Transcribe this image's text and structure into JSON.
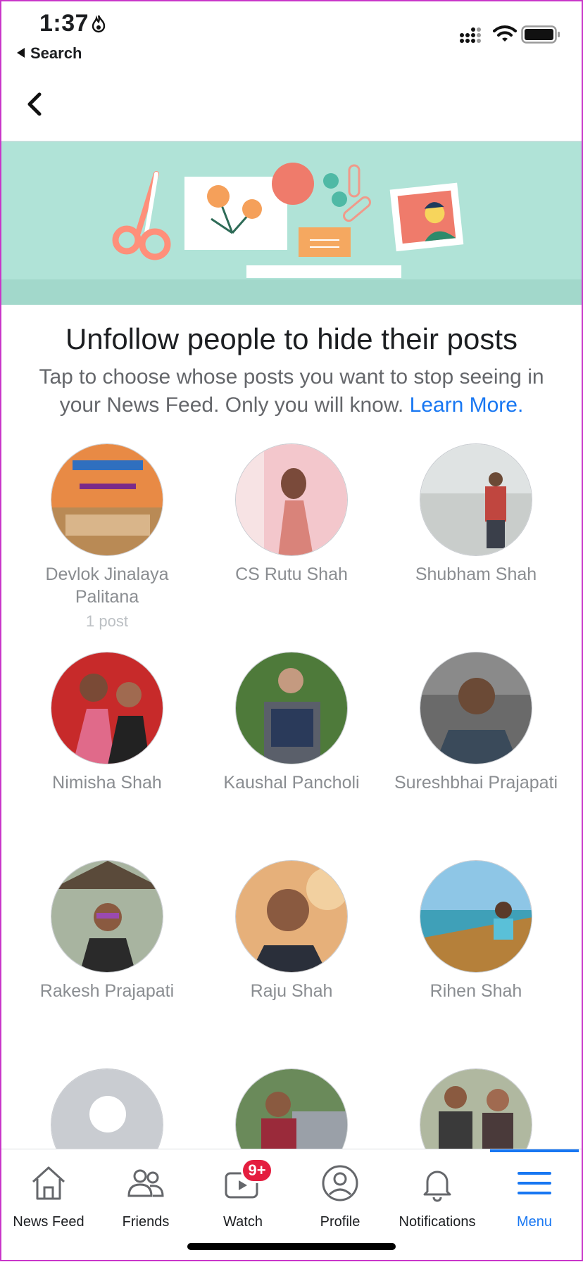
{
  "status_bar": {
    "time": "1:37",
    "back_app": "Search",
    "icons": [
      "flame-icon",
      "cellular-signal-icon",
      "wifi-icon",
      "battery-icon"
    ]
  },
  "nav": {
    "back_icon": "chevron-left-icon"
  },
  "banner": {
    "illustration": "scissors-flowers-paperclip-photo"
  },
  "header": {
    "title": "Unfollow people to hide their posts",
    "description": "Tap to choose whose posts you want to stop seeing in your News Feed. Only you will know.",
    "link": "Learn More."
  },
  "people": [
    {
      "name": "Devlok Jinalaya Palitana",
      "meta": "1 post"
    },
    {
      "name": "CS Rutu Shah",
      "meta": ""
    },
    {
      "name": "Shubham Shah",
      "meta": ""
    },
    {
      "name": "Nimisha Shah",
      "meta": ""
    },
    {
      "name": "Kaushal Pancholi",
      "meta": ""
    },
    {
      "name": "Sureshbhai Prajapati",
      "meta": ""
    },
    {
      "name": "Rakesh Prajapati",
      "meta": ""
    },
    {
      "name": "Raju Shah",
      "meta": ""
    },
    {
      "name": "Rihen Shah",
      "meta": ""
    },
    {
      "name": "",
      "meta": ""
    },
    {
      "name": "",
      "meta": ""
    },
    {
      "name": "",
      "meta": ""
    }
  ],
  "tabbar": {
    "tabs": [
      {
        "label": "News Feed",
        "icon": "home-icon"
      },
      {
        "label": "Friends",
        "icon": "friends-icon"
      },
      {
        "label": "Watch",
        "icon": "watch-icon",
        "badge": "9+"
      },
      {
        "label": "Profile",
        "icon": "profile-icon"
      },
      {
        "label": "Notifications",
        "icon": "bell-icon"
      },
      {
        "label": "Menu",
        "icon": "menu-icon",
        "active": true
      }
    ]
  },
  "colors": {
    "accent": "#1877f2",
    "banner_bg": "#b0e3d7",
    "badge": "#e41e3f",
    "muted_text": "#8a8d91"
  }
}
